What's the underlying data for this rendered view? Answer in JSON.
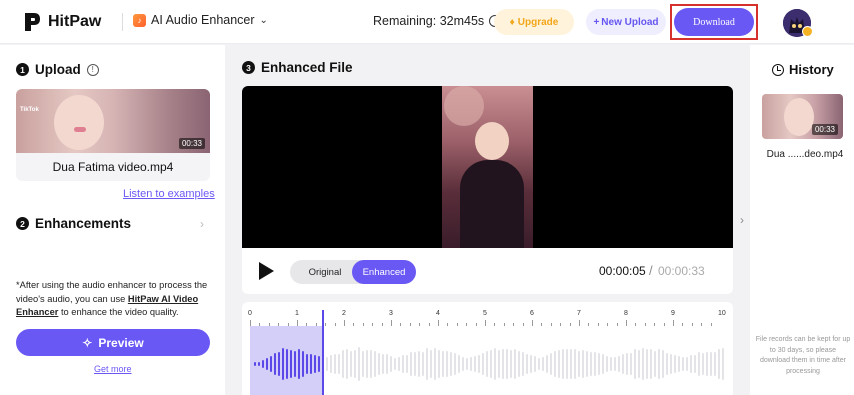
{
  "header": {
    "logo_text": "HitPaw",
    "product_name": "AI Audio Enhancer",
    "remaining": "Remaining: 32m45s",
    "upgrade_label": "Upgrade",
    "new_upload_label": "New Upload",
    "download_label": "Download",
    "accent_color": "#6a58f4",
    "highlight_color": "#d6312a"
  },
  "left": {
    "upload": {
      "step": "1",
      "title": "Upload"
    },
    "file": {
      "name": "Dua Fatima video.mp4",
      "duration": "00:33",
      "watermark": "TikTok"
    },
    "listen_link": "Listen to examples",
    "enhancements": {
      "step": "2",
      "title": "Enhancements"
    },
    "note_pre": "*After using the audio enhancer to process the video's audio, you can use ",
    "note_link": "HitPaw AI Video Enhancer",
    "note_post": " to enhance the video quality.",
    "preview_label": "Preview",
    "get_more": "Get more"
  },
  "center": {
    "step": "3",
    "title": "Enhanced File",
    "mode_original": "Original",
    "mode_enhanced": "Enhanced",
    "selected_mode": "Enhanced",
    "time_current": "00:00:05",
    "time_separator": "/",
    "time_total": "00:00:33",
    "ticks": [
      "0",
      "1",
      "2",
      "3",
      "4",
      "5",
      "6",
      "7",
      "8",
      "9",
      "10"
    ]
  },
  "history": {
    "title": "History",
    "item_name": "Dua ......deo.mp4",
    "item_duration": "00:33",
    "note": "File records can be kept for up to 30 days, so please download them in time after processing"
  }
}
